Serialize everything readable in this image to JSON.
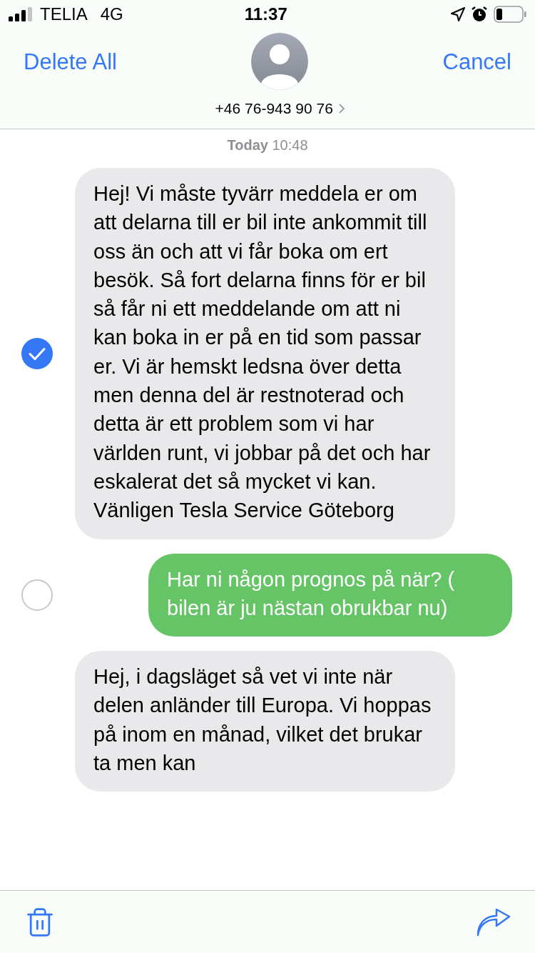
{
  "status_bar": {
    "carrier": "TELIA",
    "network": "4G",
    "time": "11:37"
  },
  "header": {
    "left_action": "Delete All",
    "right_action": "Cancel",
    "contact": "+46 76-943 90 76"
  },
  "timestamp": {
    "day": "Today",
    "time": "10:48"
  },
  "messages": [
    {
      "kind": "incoming",
      "selected": true,
      "text": "Hej! Vi måste tyvärr meddela er om att delarna till er bil inte ankommit till oss än och att vi får boka om ert besök. Så fort delarna finns för er bil så får ni ett meddelande om att ni kan boka in er på en tid som passar er. Vi är hemskt ledsna över detta men denna del är restnoterad och detta är ett problem som vi har världen runt, vi jobbar på det och har eskalerat det så mycket vi kan. Vänligen Tesla Service Göteborg"
    },
    {
      "kind": "outgoing",
      "selected": false,
      "text": "Har ni någon prognos på när? ( bilen är ju nästan obrukbar nu)"
    },
    {
      "kind": "incoming",
      "text": "Hej, i dagsläget så vet vi inte när delen anländer till Europa. Vi hoppas på inom en månad, vilket det brukar ta men kan"
    }
  ]
}
